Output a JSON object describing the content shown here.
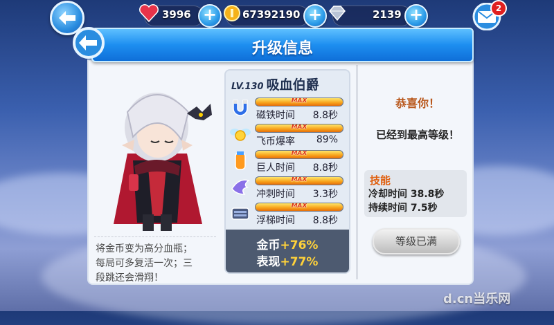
{
  "topbar": {
    "hearts": "3996",
    "coins": "67392190",
    "gems": "2139",
    "mail_count": "2"
  },
  "dialog": {
    "title": "升级信息",
    "hero": {
      "level_tag": "LV.130",
      "name": "吸血伯爵",
      "description": [
        "将金币变为高分血瓶；",
        "每局可多复活一次；三",
        "段跳还会滑翔！"
      ]
    },
    "stats": [
      {
        "icon": "magnet-icon",
        "label": "磁铁时间",
        "value": "8.8秒",
        "level": 1.0,
        "tag": "MAX"
      },
      {
        "icon": "fairy-icon",
        "label": "飞币爆率",
        "value": "89%",
        "level": 1.0,
        "tag": "MAX"
      },
      {
        "icon": "giant-potion-icon",
        "label": "巨人时间",
        "value": "8.8秒",
        "level": 1.0,
        "tag": "MAX"
      },
      {
        "icon": "dash-wing-icon",
        "label": "冲刺时间",
        "value": "3.3秒",
        "level": 1.0,
        "tag": "MAX"
      },
      {
        "icon": "float-board-icon",
        "label": "浮梯时间",
        "value": "8.8秒",
        "level": 1.0,
        "tag": "MAX"
      }
    ],
    "bonus": {
      "coins_label": "金币",
      "coins_value": "+76%",
      "perf_label": "表现",
      "perf_value": "+77%"
    },
    "congrats": "恭喜你！",
    "max_level_text": "已经到最高等级！",
    "skill": {
      "title": "技能",
      "cooldown_label": "冷却时间",
      "cooldown_value": "38.8秒",
      "duration_label": "持续时间",
      "duration_value": "7.5秒"
    },
    "level_button": "等级已满"
  },
  "watermark": "d.cn当乐网",
  "colors": {
    "header_blue": "#1d8ef0",
    "bar_orange": "#f7a11a",
    "bonus_yellow": "#ffd23a",
    "skill_orange": "#e06010"
  }
}
